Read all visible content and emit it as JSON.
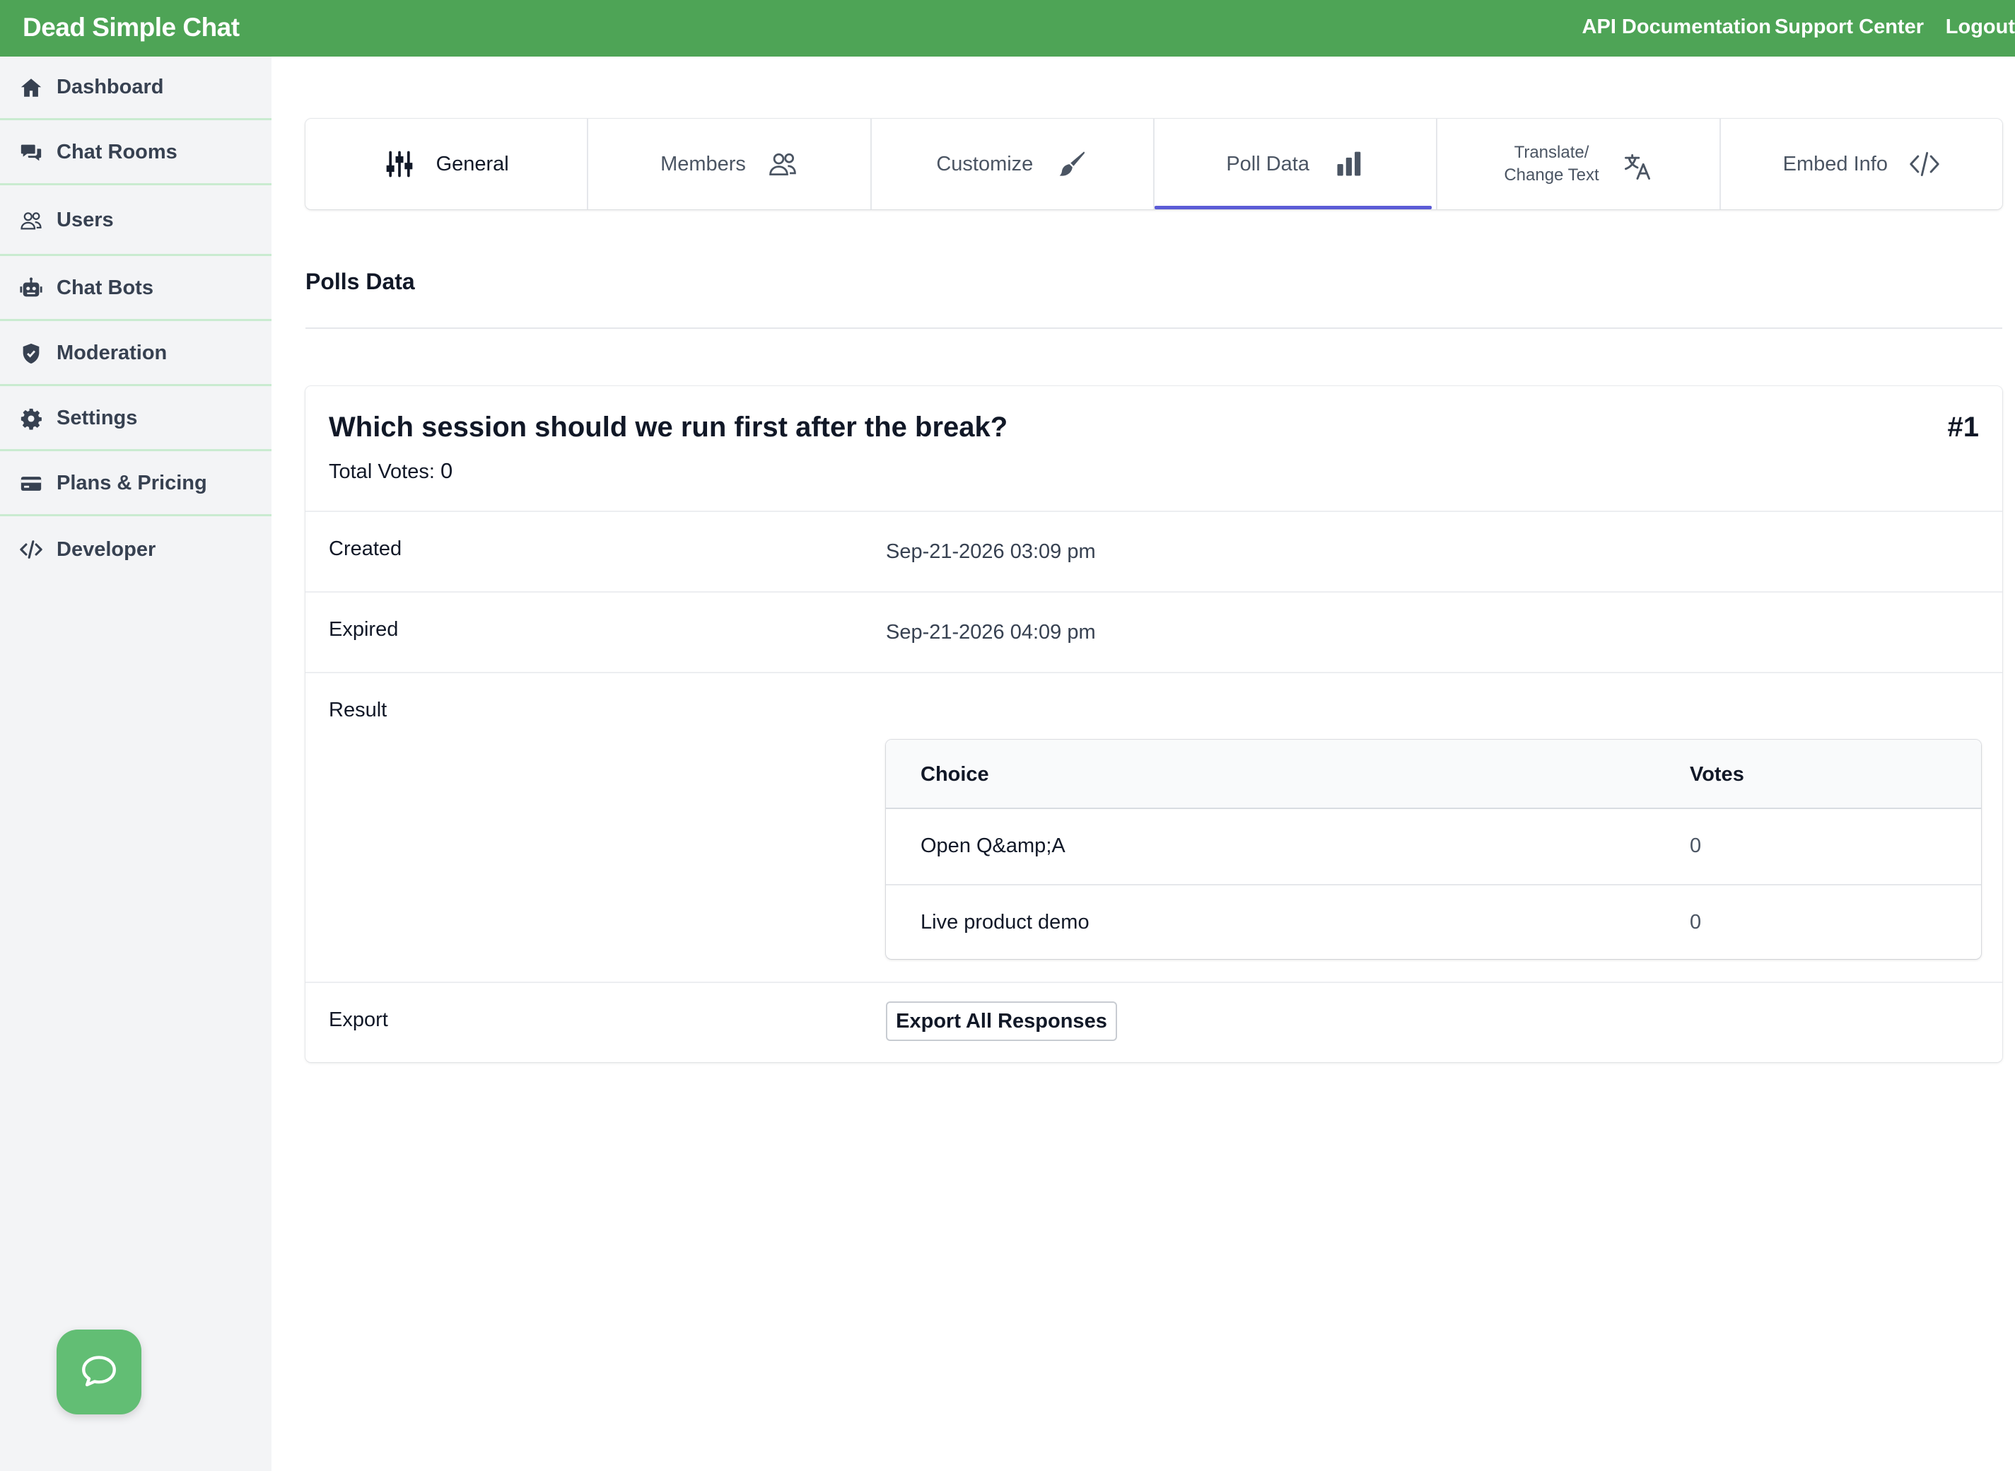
{
  "app": {
    "brand": "Dead Simple Chat",
    "nav": {
      "api_docs": "API Documentation",
      "support": "Support Center",
      "logout": "Logout"
    }
  },
  "sidebar": {
    "items": [
      {
        "label": "Dashboard",
        "icon": "home-icon"
      },
      {
        "label": "Chat Rooms",
        "icon": "chat-bubbles-icon"
      },
      {
        "label": "Users",
        "icon": "users-icon"
      },
      {
        "label": "Chat Bots",
        "icon": "robot-icon"
      },
      {
        "label": "Moderation",
        "icon": "shield-check-icon"
      },
      {
        "label": "Settings",
        "icon": "gear-icon"
      },
      {
        "label": "Plans & Pricing",
        "icon": "credit-card-icon"
      },
      {
        "label": "Developer",
        "icon": "code-icon"
      }
    ]
  },
  "tabs": {
    "general": "General",
    "members": "Members",
    "customize": "Customize",
    "poll_data": "Poll Data",
    "translate_line1": "Translate/",
    "translate_line2": "Change Text",
    "embed": "Embed Info",
    "active": "Poll Data"
  },
  "page": {
    "section_title": "Polls Data"
  },
  "poll": {
    "question": "Which session should we run first after the break?",
    "number": "#1",
    "total_votes_label": "Total Votes:",
    "total_votes": "0",
    "created_label": "Created",
    "created": "Sep-21-2026 03:09 pm",
    "expired_label": "Expired",
    "expired": "Sep-21-2026 04:09 pm",
    "result_label": "Result",
    "export_label": "Export",
    "export_button": "Export All Responses",
    "table": {
      "headers": {
        "choice": "Choice",
        "votes": "Votes"
      },
      "rows": [
        {
          "choice": "Open Q&amp;A",
          "votes": "0"
        },
        {
          "choice": "Live product demo",
          "votes": "0"
        }
      ]
    }
  },
  "colors": {
    "brand_green": "#4ea456",
    "active_tab_underline": "#5b5bd6",
    "help_bubble": "#62be74"
  }
}
